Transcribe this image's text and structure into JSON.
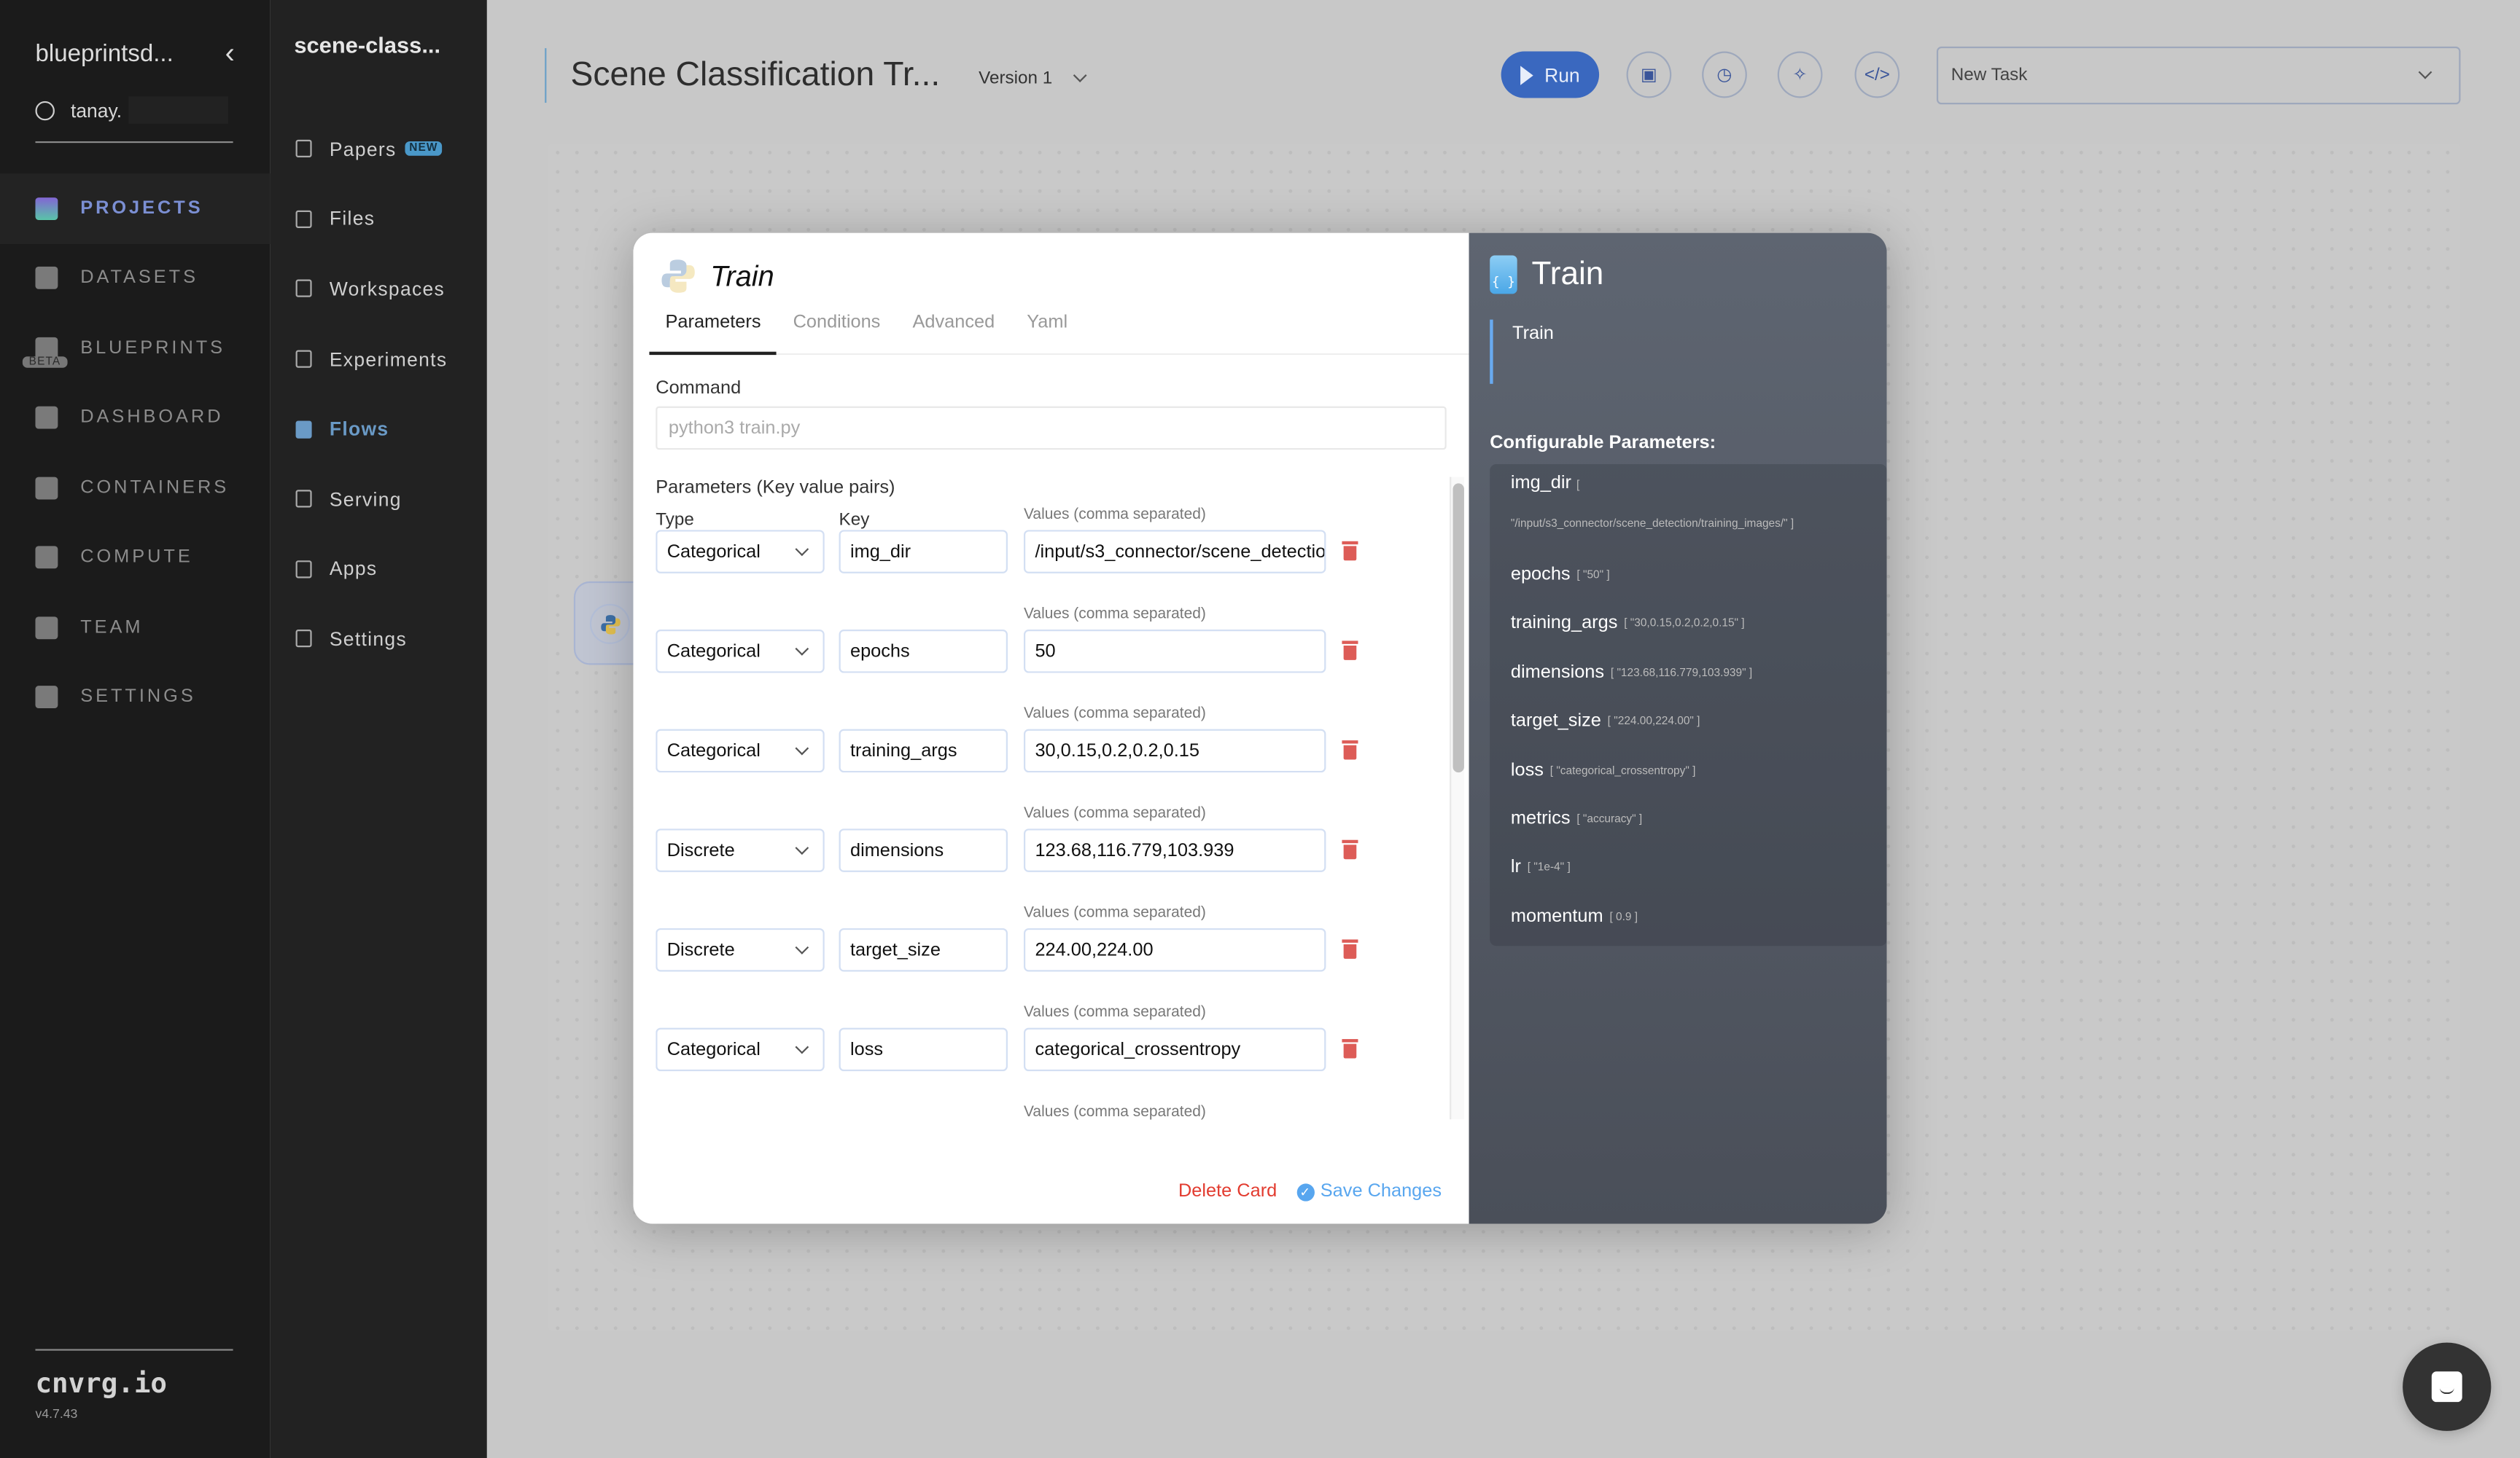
{
  "primary_nav": {
    "workspace": "blueprintsd...",
    "username": "tanay.",
    "items": [
      {
        "label": "PROJECTS",
        "icon": "projects-icon",
        "active": true
      },
      {
        "label": "DATASETS",
        "icon": "database-icon"
      },
      {
        "label": "BLUEPRINTS",
        "icon": "blueprints-icon",
        "badge": "BETA"
      },
      {
        "label": "DASHBOARD",
        "icon": "dashboard-icon"
      },
      {
        "label": "CONTAINERS",
        "icon": "containers-icon"
      },
      {
        "label": "COMPUTE",
        "icon": "cloud-icon"
      },
      {
        "label": "TEAM",
        "icon": "team-icon"
      },
      {
        "label": "SETTINGS",
        "icon": "settings-icon"
      }
    ],
    "brand": "cnvrg.io",
    "version": "v4.7.43"
  },
  "project_nav": {
    "project_name": "scene-class...",
    "items": [
      {
        "label": "Papers",
        "icon": "papers-icon",
        "badge": "NEW"
      },
      {
        "label": "Files",
        "icon": "file-icon"
      },
      {
        "label": "Workspaces",
        "icon": "clipboard-icon"
      },
      {
        "label": "Experiments",
        "icon": "flask-icon"
      },
      {
        "label": "Flows",
        "icon": "flows-icon",
        "active": true
      },
      {
        "label": "Serving",
        "icon": "rocket-icon"
      },
      {
        "label": "Apps",
        "icon": "grid-icon"
      },
      {
        "label": "Settings",
        "icon": "gear-icon"
      }
    ]
  },
  "header": {
    "flow_title": "Scene Classification Tr...",
    "version": "Version 1",
    "run_label": "Run",
    "task_select": "New Task"
  },
  "modal": {
    "title": "Train",
    "tabs": [
      "Parameters",
      "Conditions",
      "Advanced",
      "Yaml"
    ],
    "active_tab": "Parameters",
    "command_label": "Command",
    "command_placeholder": "python3 train.py",
    "params_label": "Parameters (Key value pairs)",
    "col_type": "Type",
    "col_key": "Key",
    "values_label": "Values (comma separated)",
    "params": [
      {
        "type": "Categorical",
        "key": "img_dir",
        "value": "/input/s3_connector/scene_detection/training_images/"
      },
      {
        "type": "Categorical",
        "key": "epochs",
        "value": "50"
      },
      {
        "type": "Categorical",
        "key": "training_args",
        "value": "30,0.15,0.2,0.2,0.15"
      },
      {
        "type": "Discrete",
        "key": "dimensions",
        "value": "123.68,116.779,103.939"
      },
      {
        "type": "Discrete",
        "key": "target_size",
        "value": "224.00,224.00"
      },
      {
        "type": "Categorical",
        "key": "loss",
        "value": "categorical_crossentropy"
      }
    ],
    "delete_label": "Delete Card",
    "save_label": "Save Changes",
    "side": {
      "title": "Train",
      "description": "Train",
      "configurable_label": "Configurable Parameters:",
      "items": [
        {
          "name": "img_dir",
          "value": "[ \"/input/s3_connector/scene_detection/training_images/\" ]"
        },
        {
          "name": "epochs",
          "value": "[ \"50\" ]"
        },
        {
          "name": "training_args",
          "value": "[ \"30,0.15,0.2,0.2,0.15\" ]"
        },
        {
          "name": "dimensions",
          "value": "[ \"123.68,116.779,103.939\" ]"
        },
        {
          "name": "target_size",
          "value": "[ \"224.00,224.00\" ]"
        },
        {
          "name": "loss",
          "value": "[ \"categorical_crossentropy\" ]"
        },
        {
          "name": "metrics",
          "value": "[ \"accuracy\" ]"
        },
        {
          "name": "lr",
          "value": "[ \"1e-4\" ]"
        },
        {
          "name": "momentum",
          "value": "[ 0.9 ]"
        }
      ]
    }
  },
  "colors": {
    "accent": "#3a68bf",
    "danger": "#e23b2f",
    "save": "#58a6ef",
    "flows_active": "#6a9ac6"
  }
}
